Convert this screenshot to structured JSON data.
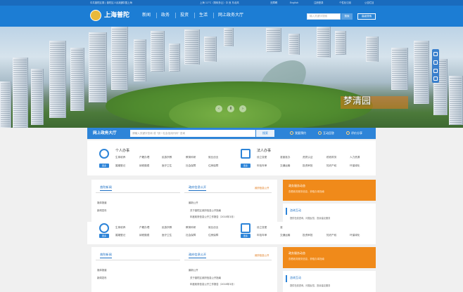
{
  "topbar": {
    "left_text": "中共普陀区委 | 普陀区人民政府",
    "mid_text": "| 中国上海",
    "weather": "上海  11°C（阴转多云）中 良 东北风",
    "links": [
      "无障碍",
      "English",
      "注册登录",
      "个性化订阅",
      "公告栏目"
    ]
  },
  "header": {
    "logo_text": "上海普陀",
    "nav": [
      "新闻",
      "政务",
      "投资",
      "生活",
      "网上政务大厅"
    ],
    "search_placeholder": "输入关键字搜索",
    "search_btn": "搜索",
    "adv_search": "高级搜索"
  },
  "hero": {
    "caption": "梦清园",
    "prev": "‹",
    "pause": "II",
    "next": "›"
  },
  "service": {
    "title": "网上政务大厅",
    "input_placeholder": "请输入关键字查询 或 \"统一社会信用代码\" 查询",
    "search_btn": "搜索",
    "links": [
      "我要预约",
      "互动回答",
      "评价分享"
    ]
  },
  "personal": {
    "title": "个人办事",
    "btn": "更多",
    "items": [
      "生育收养",
      "户籍办理",
      "民族宗教",
      "教育科研",
      "就业创业",
      "婚姻登记",
      "纳税缴费",
      "医疗卫生",
      "社会保障",
      "住房保障"
    ]
  },
  "legal": {
    "title": "法人办事",
    "btn": "更多",
    "items": [
      "设立变更",
      "准营准办",
      "资质认证",
      "税收财务",
      "人力资源",
      "年检年审",
      "交通运输",
      "投资审批",
      "知识产权",
      "环保绿化"
    ]
  },
  "news_block": {
    "tabs": [
      "普陀新闻",
      "政府信息公开"
    ],
    "more": "政府信息公开",
    "left_head": "媒体报道",
    "left_item": "新闻发布",
    "right_head": "最新公开",
    "right_items": [
      "关于普陀区政府信息公开指南",
      "年度政府信息公开工作报告（2018年3月）"
    ]
  },
  "side_cards": {
    "orange_title": "政务服务动态",
    "orange_sub": "查看政务服务信息，获取办事指南",
    "blue_title": "咨询互动",
    "blue_desc": "提供在线咨询，问题反馈，投诉建议服务"
  },
  "colors": {
    "primary": "#1c7dd4",
    "accent": "#f08a1a"
  }
}
